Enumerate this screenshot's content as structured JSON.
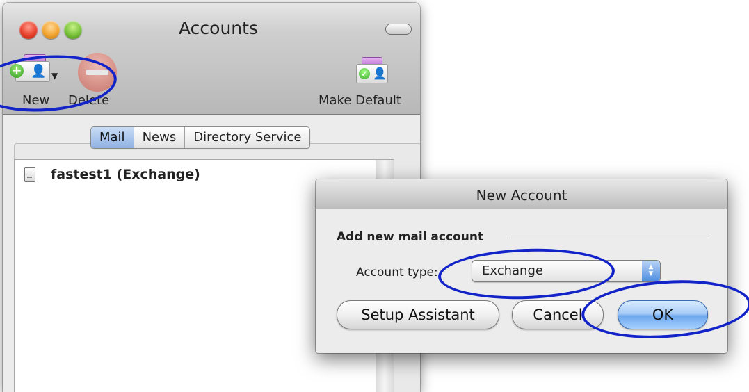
{
  "accounts_window": {
    "title": "Accounts",
    "toolbar": {
      "new_label": "New",
      "delete_label": "Delete",
      "make_default_label": "Make Default",
      "icons": {
        "new": "new-account-icon",
        "delete": "delete-icon",
        "make_default": "make-default-icon"
      }
    },
    "tabs": [
      {
        "label": "Mail",
        "selected": true
      },
      {
        "label": "News",
        "selected": false
      },
      {
        "label": "Directory Service",
        "selected": false
      }
    ],
    "accounts": [
      {
        "name": "fastest1 (Exchange)",
        "icon": "account-icon"
      }
    ]
  },
  "new_account_dialog": {
    "title": "New Account",
    "section_label": "Add new mail account",
    "account_type_label": "Account type:",
    "account_type_value": "Exchange",
    "buttons": {
      "setup_assistant": "Setup Assistant",
      "cancel": "Cancel",
      "ok": "OK"
    }
  },
  "annotation_color": "#1224c8"
}
